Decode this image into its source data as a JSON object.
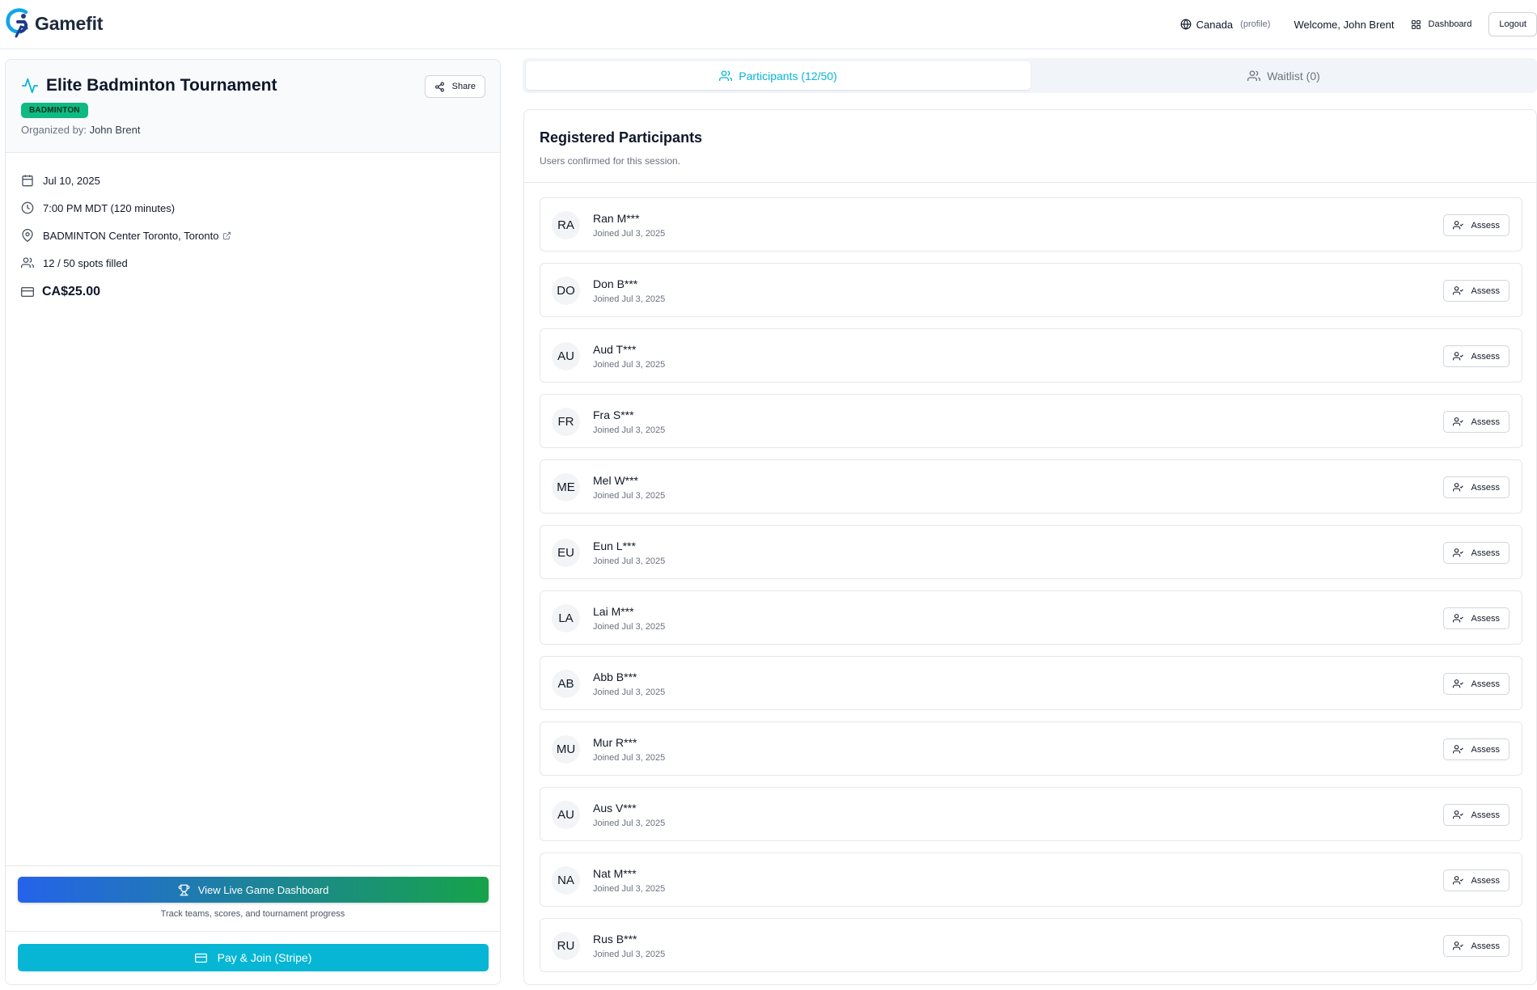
{
  "header": {
    "brand": "Gamefit",
    "country": "Canada",
    "profile_label": "(profile)",
    "welcome": "Welcome, John Brent",
    "dashboard_label": "Dashboard",
    "logout_label": "Logout"
  },
  "event": {
    "title": "Elite Badminton Tournament",
    "share_label": "Share",
    "sport_badge": "BADMINTON",
    "organizer_prefix": "Organized by:",
    "organizer_name": "John Brent",
    "date": "Jul 10, 2025",
    "time": "7:00 PM MDT (120 minutes)",
    "location": "BADMINTON Center Toronto, Toronto",
    "spots": "12 / 50 spots filled",
    "price": "CA$25.00",
    "live_dashboard_label": "View Live Game Dashboard",
    "live_dashboard_note": "Track teams, scores, and tournament progress",
    "pay_label": "Pay & Join (Stripe)"
  },
  "tabs": {
    "participants": "Participants (12/50)",
    "waitlist": "Waitlist (0)"
  },
  "participants_panel": {
    "title": "Registered Participants",
    "subtitle": "Users confirmed for this session.",
    "assess_label": "Assess",
    "items": [
      {
        "initials": "RA",
        "name": "Ran M***",
        "joined": "Joined Jul 3, 2025"
      },
      {
        "initials": "DO",
        "name": "Don B***",
        "joined": "Joined Jul 3, 2025"
      },
      {
        "initials": "AU",
        "name": "Aud T***",
        "joined": "Joined Jul 3, 2025"
      },
      {
        "initials": "FR",
        "name": "Fra S***",
        "joined": "Joined Jul 3, 2025"
      },
      {
        "initials": "ME",
        "name": "Mel W***",
        "joined": "Joined Jul 3, 2025"
      },
      {
        "initials": "EU",
        "name": "Eun L***",
        "joined": "Joined Jul 3, 2025"
      },
      {
        "initials": "LA",
        "name": "Lai M***",
        "joined": "Joined Jul 3, 2025"
      },
      {
        "initials": "AB",
        "name": "Abb B***",
        "joined": "Joined Jul 3, 2025"
      },
      {
        "initials": "MU",
        "name": "Mur R***",
        "joined": "Joined Jul 3, 2025"
      },
      {
        "initials": "AU",
        "name": "Aus V***",
        "joined": "Joined Jul 3, 2025"
      },
      {
        "initials": "NA",
        "name": "Nat M***",
        "joined": "Joined Jul 3, 2025"
      },
      {
        "initials": "RU",
        "name": "Rus B***",
        "joined": "Joined Jul 3, 2025"
      }
    ]
  },
  "colors": {
    "accent": "#06b6d4",
    "badge": "#10b981",
    "gradient_start": "#2563eb",
    "gradient_end": "#16a34a"
  }
}
